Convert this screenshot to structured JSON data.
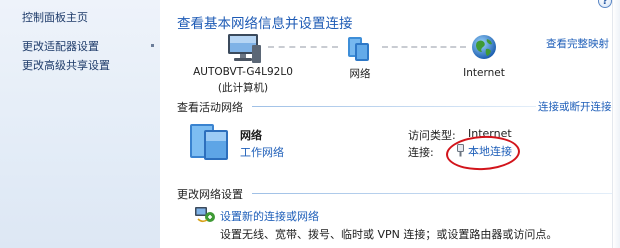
{
  "sidebar": {
    "home": "控制面板主页",
    "items": [
      {
        "label": "更改适配器设置"
      },
      {
        "label": "更改高级共享设置"
      }
    ]
  },
  "main": {
    "title": "查看基本网络信息并设置连接",
    "full_map_link": "查看完整映射",
    "map": {
      "computer": {
        "name": "AUTOBVT-G4L92L0",
        "sub": "(此计算机)",
        "icon": "computer-icon"
      },
      "network": {
        "name": "网络",
        "icon": "network-icon"
      },
      "internet": {
        "name": "Internet",
        "icon": "globe-icon"
      }
    },
    "active_networks": {
      "heading": "查看活动网络",
      "action_link": "连接或断开连接",
      "network_name": "网络",
      "network_type": "工作网络",
      "access_type_label": "访问类型:",
      "access_type_value": "Internet",
      "connection_label": "连接:",
      "connection_value": "本地连接",
      "connection_icon": "ethernet-icon"
    },
    "change_settings": {
      "heading": "更改网络设置",
      "setup_link": "设置新的连接或网络",
      "setup_desc": "设置无线、宽带、拨号、临时或 VPN 连接；或设置路由器或访问点。",
      "setup_icon": "new-connection-icon"
    }
  },
  "colors": {
    "link": "#1f5fb9",
    "title": "#1e5bb5",
    "highlight_ellipse": "#d2141b"
  }
}
